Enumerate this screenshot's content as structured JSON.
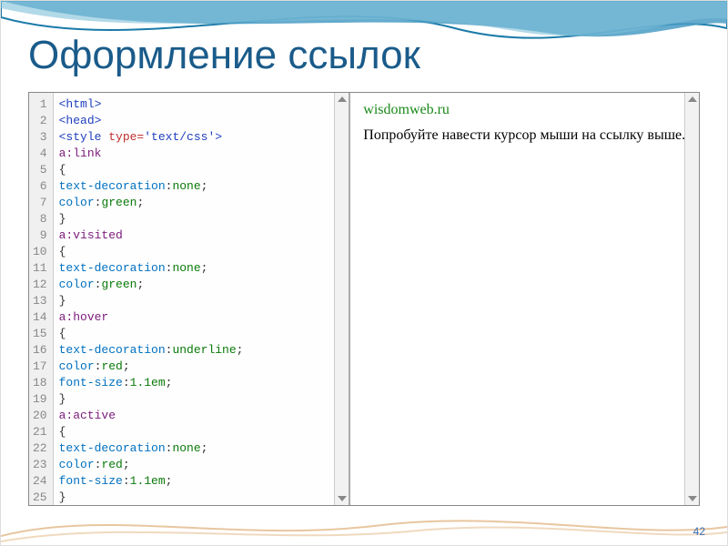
{
  "title": "Оформление ссылок",
  "page_number": "42",
  "preview": {
    "link_text": "wisdomweb.ru",
    "body_text": "Попробуйте навести курсор мыши на ссылку выше."
  },
  "code": {
    "lines": [
      [
        {
          "t": "<html>",
          "c": "c-tag"
        }
      ],
      [
        {
          "t": "<head>",
          "c": "c-tag"
        }
      ],
      [
        {
          "t": "<style ",
          "c": "c-tag"
        },
        {
          "t": "type=",
          "c": "c-attr"
        },
        {
          "t": "'text/css'",
          "c": "c-str"
        },
        {
          "t": ">",
          "c": "c-tag"
        }
      ],
      [
        {
          "t": "a:link",
          "c": "c-sel"
        }
      ],
      [
        {
          "t": "{",
          "c": "c-punct"
        }
      ],
      [
        {
          "t": "text-decoration",
          "c": "c-prop"
        },
        {
          "t": ":",
          "c": "c-punct"
        },
        {
          "t": "none",
          "c": "c-none"
        },
        {
          "t": ";",
          "c": "c-punct"
        }
      ],
      [
        {
          "t": "color",
          "c": "c-prop"
        },
        {
          "t": ":",
          "c": "c-punct"
        },
        {
          "t": "green",
          "c": "c-green"
        },
        {
          "t": ";",
          "c": "c-punct"
        }
      ],
      [
        {
          "t": "}",
          "c": "c-punct"
        }
      ],
      [
        {
          "t": "a:visited",
          "c": "c-sel"
        }
      ],
      [
        {
          "t": "{",
          "c": "c-punct"
        }
      ],
      [
        {
          "t": "text-decoration",
          "c": "c-prop"
        },
        {
          "t": ":",
          "c": "c-punct"
        },
        {
          "t": "none",
          "c": "c-none"
        },
        {
          "t": ";",
          "c": "c-punct"
        }
      ],
      [
        {
          "t": "color",
          "c": "c-prop"
        },
        {
          "t": ":",
          "c": "c-punct"
        },
        {
          "t": "green",
          "c": "c-green"
        },
        {
          "t": ";",
          "c": "c-punct"
        }
      ],
      [
        {
          "t": "}",
          "c": "c-punct"
        }
      ],
      [
        {
          "t": "a:hover",
          "c": "c-sel"
        }
      ],
      [
        {
          "t": "{",
          "c": "c-punct"
        }
      ],
      [
        {
          "t": "text-decoration",
          "c": "c-prop"
        },
        {
          "t": ":",
          "c": "c-punct"
        },
        {
          "t": "underline",
          "c": "c-under"
        },
        {
          "t": ";",
          "c": "c-punct"
        }
      ],
      [
        {
          "t": "color",
          "c": "c-prop"
        },
        {
          "t": ":",
          "c": "c-punct"
        },
        {
          "t": "red",
          "c": "c-red"
        },
        {
          "t": ";",
          "c": "c-punct"
        }
      ],
      [
        {
          "t": "font-size",
          "c": "c-prop"
        },
        {
          "t": ":",
          "c": "c-punct"
        },
        {
          "t": "1.1em",
          "c": "c-size"
        },
        {
          "t": ";",
          "c": "c-punct"
        }
      ],
      [
        {
          "t": "}",
          "c": "c-punct"
        }
      ],
      [
        {
          "t": "a:active",
          "c": "c-sel"
        }
      ],
      [
        {
          "t": "{",
          "c": "c-punct"
        }
      ],
      [
        {
          "t": "text-decoration",
          "c": "c-prop"
        },
        {
          "t": ":",
          "c": "c-punct"
        },
        {
          "t": "none",
          "c": "c-none"
        },
        {
          "t": ";",
          "c": "c-punct"
        }
      ],
      [
        {
          "t": "color",
          "c": "c-prop"
        },
        {
          "t": ":",
          "c": "c-punct"
        },
        {
          "t": "red",
          "c": "c-red"
        },
        {
          "t": ";",
          "c": "c-punct"
        }
      ],
      [
        {
          "t": "font-size",
          "c": "c-prop"
        },
        {
          "t": ":",
          "c": "c-punct"
        },
        {
          "t": "1.1em",
          "c": "c-size"
        },
        {
          "t": ";",
          "c": "c-punct"
        }
      ],
      [
        {
          "t": "}",
          "c": "c-punct"
        }
      ]
    ]
  }
}
